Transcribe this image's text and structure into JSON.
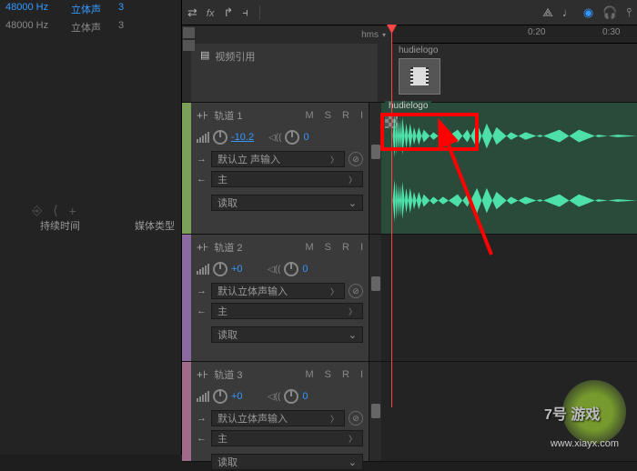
{
  "files": [
    {
      "hz": "48000 Hz",
      "ch": "立体声",
      "n": "3"
    },
    {
      "hz": "48000 Hz",
      "ch": "立体声",
      "n": "3"
    }
  ],
  "bottom_tools": {
    "duration": "持续时间",
    "media_type": "媒体类型"
  },
  "toolbar": {
    "hms": "hms"
  },
  "ruler": {
    "t1": "0:20",
    "t2": "0:30"
  },
  "video_track": {
    "label": "视频引用",
    "clip": "hudielogo"
  },
  "tracks": [
    {
      "name": "轨道 1",
      "m": "M",
      "s": "S",
      "r": "R",
      "vol": "-10.2",
      "vol_neg": true,
      "pan": "0",
      "input": "默认立    声输入",
      "output": "主",
      "mode": "读取",
      "clip": "hudielogo",
      "has_wave": true
    },
    {
      "name": "轨道 2",
      "m": "M",
      "s": "S",
      "r": "R",
      "vol": "+0",
      "vol_neg": false,
      "pan": "0",
      "input": "默认立体声输入",
      "output": "主",
      "mode": "读取",
      "has_wave": false
    },
    {
      "name": "轨道 3",
      "m": "M",
      "s": "S",
      "r": "R",
      "vol": "+0",
      "vol_neg": false,
      "pan": "0",
      "input": "默认立体声输入",
      "output": "主",
      "mode": "读取",
      "has_wave": false
    }
  ],
  "watermark": {
    "main": "7号 游戏",
    "sub": "www.xiayx.com"
  }
}
